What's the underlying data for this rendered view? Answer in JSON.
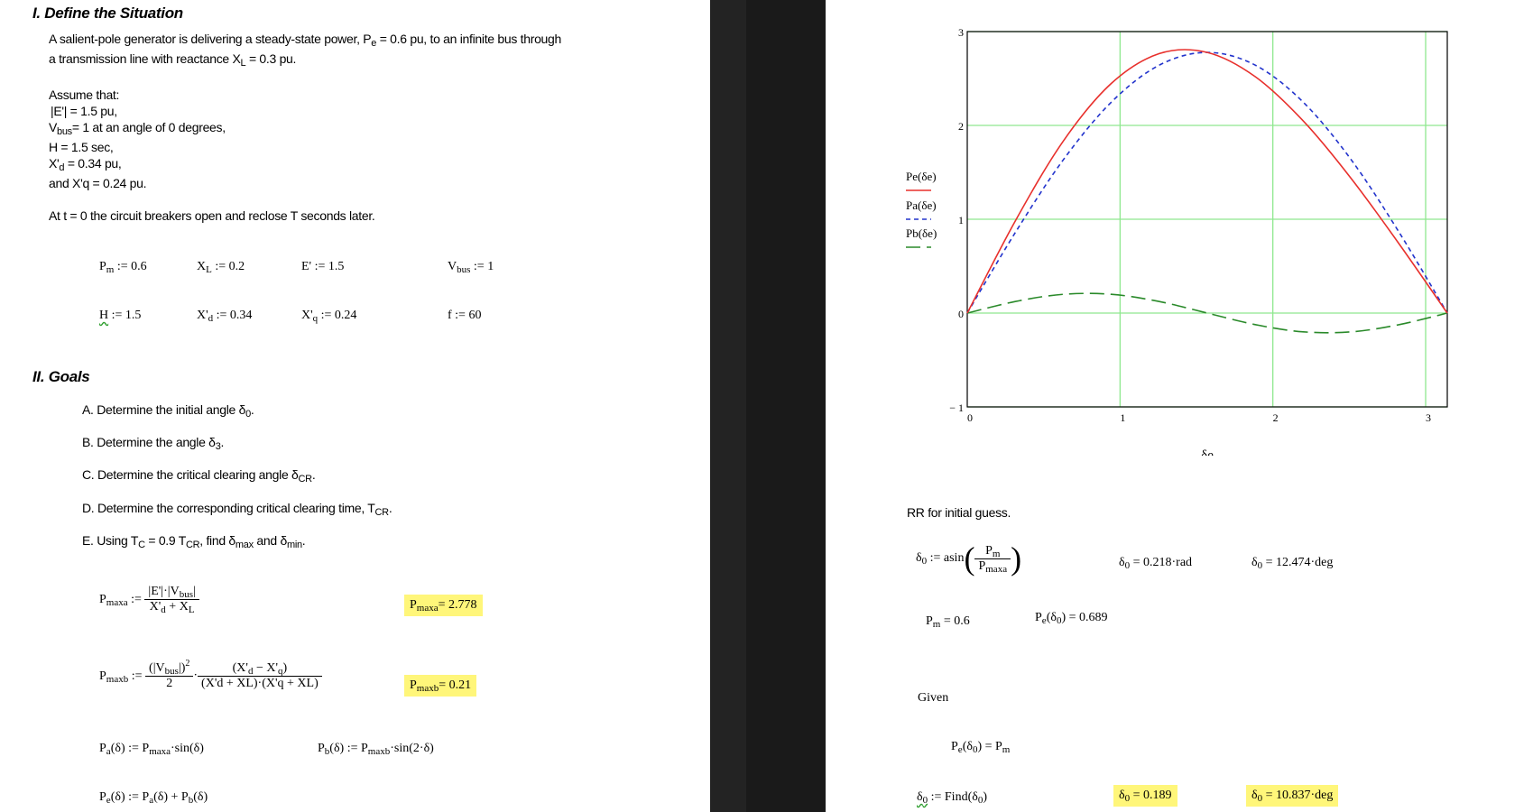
{
  "section1": {
    "heading": "I. Define the Situation",
    "intro_line1_a": "A salient-pole generator is delivering a steady-state power, P",
    "intro_line1_sub": "e",
    "intro_line1_b": " = 0.6 pu, to an infinite bus through",
    "intro_line2_a": "a transmission line with reactance X",
    "intro_line2_sub": "L",
    "intro_line2_b": " = 0.3 pu.",
    "assume": "Assume that:",
    "cond_E": "|E'| = 1.5 pu,",
    "cond_V_a": "V",
    "cond_V_sub": "bus",
    "cond_V_b": "= 1 at an angle of 0 degrees,",
    "cond_H": "H = 1.5 sec,",
    "cond_Xd_a": "X'",
    "cond_Xd_sub": "d",
    "cond_Xd_b": " = 0.34 pu,",
    "cond_Xq": "and X'q = 0.24 pu.",
    "breaker": "At t = 0 the circuit breakers open and reclose T seconds later."
  },
  "definitions": {
    "Pm": {
      "sym": "P",
      "sub": "m",
      "val": " := 0.6"
    },
    "XL": {
      "sym": "X",
      "sub": "L",
      "val": " := 0.2"
    },
    "E": {
      "sym": "E'",
      "val": " := 1.5"
    },
    "Vbus": {
      "sym": "V",
      "sub": "bus",
      "val": " := 1"
    },
    "H": {
      "sym": "H",
      "val": " := 1.5"
    },
    "Xd": {
      "sym": "X'",
      "sub": "d",
      "val": " := 0.34"
    },
    "Xq": {
      "sym": "X'",
      "sub": "q",
      "val": " := 0.24"
    },
    "f": {
      "sym": "f",
      "val": " := 60"
    }
  },
  "section2": {
    "heading": "II. Goals",
    "goals": [
      {
        "text": "A. Determine the initial angle δ",
        "sub": "0",
        "tail": "."
      },
      {
        "text": "B. Determine the angle δ",
        "sub": "3",
        "tail": "."
      },
      {
        "text": "C. Determine the critical clearing angle δ",
        "sub": "CR",
        "tail": "."
      },
      {
        "text": "D. Determine the corresponding critical clearing time, T",
        "sub": "CR",
        "tail": "."
      }
    ],
    "goal_e_a": "E. Using T",
    "goal_e_sub1": "C",
    "goal_e_b": " = 0.9 T",
    "goal_e_sub2": "CR",
    "goal_e_c": ", find δ",
    "goal_e_sub3": "max",
    "goal_e_d": " and δ",
    "goal_e_sub4": "min",
    "goal_e_e": "."
  },
  "equations": {
    "pmaxa_lhs_sym": "P",
    "pmaxa_lhs_sub": "maxa",
    "assign": " :=",
    "pmaxa_num": "|E'|·|V",
    "pmaxa_num_sub": "bus",
    "pmaxa_num_tail": "|",
    "pmaxa_den_a": "X'",
    "pmaxa_den_sub1": "d",
    "pmaxa_den_b": " + X",
    "pmaxa_den_sub2": "L",
    "pmaxa_result": "= 2.778",
    "pmaxb_lhs_sub": "maxb",
    "pmaxb_num1": "(|V",
    "pmaxb_num1_sub": "bus",
    "pmaxb_num1_tail": "|)",
    "pmaxb_num1_sup": "2",
    "pmaxb_den1": "2",
    "pmaxb_num2": "(X'",
    "pmaxb_num2_sub1": "d",
    "pmaxb_num2_mid": " − X'",
    "pmaxb_num2_sub2": "q",
    "pmaxb_num2_tail": ")",
    "pmaxb_den2": "(X'd + XL)·(X'q + XL)",
    "pmaxb_result": "= 0.21",
    "pa_def": "P",
    "pa_sub": "a",
    "pa_rhs_a": "(δ) := P",
    "pa_rhs_sub": "maxa",
    "pa_rhs_b": "·sin(δ)",
    "pb_sub": "b",
    "pb_rhs_sub": "maxb",
    "pb_rhs_b": "·sin(2·δ)",
    "pe_sub": "e",
    "pe_rhs": "(δ) := P",
    "pe_rhs_a_sub": "a",
    "pe_rhs_mid": "(δ) + P",
    "pe_rhs_b_sub": "b",
    "pe_rhs_tail": "(δ)"
  },
  "chart_data": {
    "type": "line",
    "xlabel": "δe",
    "xlim": [
      0,
      3.1416
    ],
    "ylim": [
      -1,
      3
    ],
    "x_ticks": [
      "0",
      "1",
      "2",
      "3"
    ],
    "y_ticks": [
      "3",
      "2",
      "1",
      "0",
      "− 1"
    ],
    "grid": true,
    "legend_placement": "left",
    "series": [
      {
        "name": "Pe(δe)",
        "color": "#e8302c",
        "dash": "solid",
        "formula": "2.778*sin(x)+0.21*sin(2x)"
      },
      {
        "name": "Pa(δe)",
        "color": "#2233cc",
        "dash": "short",
        "formula": "2.778*sin(x)"
      },
      {
        "name": "Pb(δe)",
        "color": "#2a8a2a",
        "dash": "long",
        "formula": "0.21*sin(2x)"
      }
    ],
    "x_samples": [
      0,
      0.3142,
      0.6283,
      0.9425,
      1.2566,
      1.5708,
      1.885,
      2.1991,
      2.5133,
      2.8274,
      3.1416
    ],
    "pa_values": [
      0,
      0.858,
      1.633,
      2.247,
      2.642,
      2.778,
      2.642,
      2.247,
      1.633,
      0.858,
      0
    ],
    "pb_values": [
      0,
      0.123,
      0.2,
      0.2,
      0.123,
      0,
      -0.123,
      -0.2,
      -0.2,
      -0.123,
      0
    ],
    "pe_values": [
      0,
      0.981,
      1.833,
      2.447,
      2.765,
      2.778,
      2.519,
      2.047,
      1.433,
      0.735,
      0
    ]
  },
  "solve": {
    "rr_label": "RR for initial guess.",
    "d0_assign_a": "δ",
    "d0_assign_sub": "0",
    "d0_assign_b": " := asin",
    "frac_num_sym": "P",
    "frac_num_sub": "m",
    "frac_den_sym": "P",
    "frac_den_sub": "maxa",
    "d0_rad": " = 0.218·rad",
    "d0_deg": " = 12.474·deg",
    "pm_eval": " = 0.6",
    "pe_eval_a": "P",
    "pe_eval_sub": "e",
    "pe_eval_b": "(δ",
    "pe_eval_c": ") = 0.689",
    "given": "Given",
    "constraint_b": ") = P",
    "find_b": " := Find(δ",
    "find_c": ")",
    "result1": " = 0.189",
    "result2": " = 10.837·deg"
  }
}
